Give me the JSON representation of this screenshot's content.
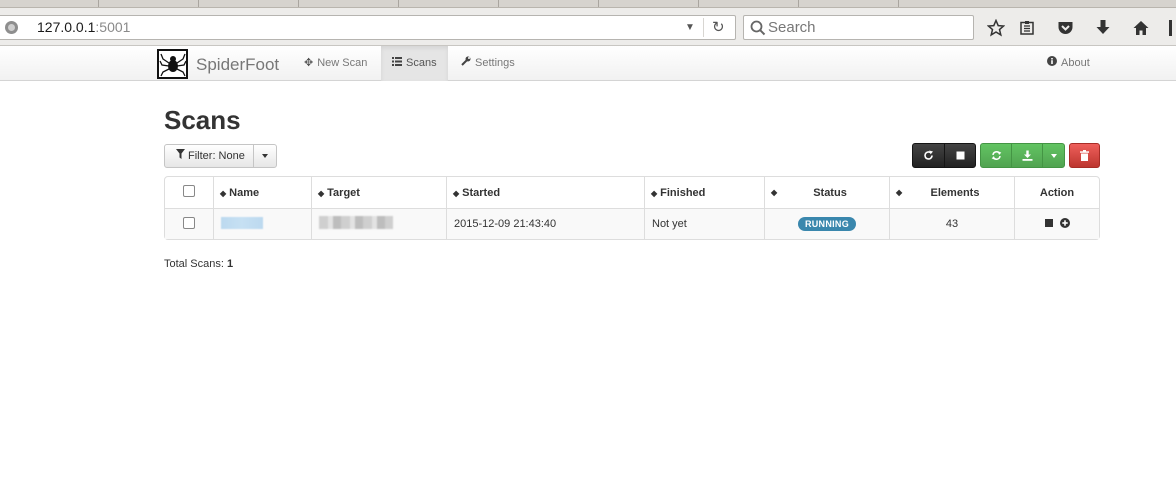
{
  "browser": {
    "url_host": "127.0.0.1",
    "url_port": ":5001",
    "search_placeholder": "Search"
  },
  "navbar": {
    "brand": "SpiderFoot",
    "items": [
      {
        "label": "New Scan",
        "icon": "move-icon"
      },
      {
        "label": "Scans",
        "icon": "list-icon"
      },
      {
        "label": "Settings",
        "icon": "wrench-icon"
      }
    ],
    "about_label": "About"
  },
  "main": {
    "title": "Scans",
    "filter_label": "Filter: None",
    "table": {
      "headers": [
        "Name",
        "Target",
        "Started",
        "Finished",
        "Status",
        "Elements",
        "Action"
      ],
      "rows": [
        {
          "started": "2015-12-09 21:43:40",
          "finished": "Not yet",
          "status": "RUNNING",
          "elements": "43"
        }
      ]
    },
    "total_label": "Total Scans:",
    "total_value": "1"
  },
  "colors": {
    "status_running": "#3a87ad",
    "btn_dark": "#222222",
    "btn_green": "#51a351",
    "btn_red": "#bd362f"
  }
}
